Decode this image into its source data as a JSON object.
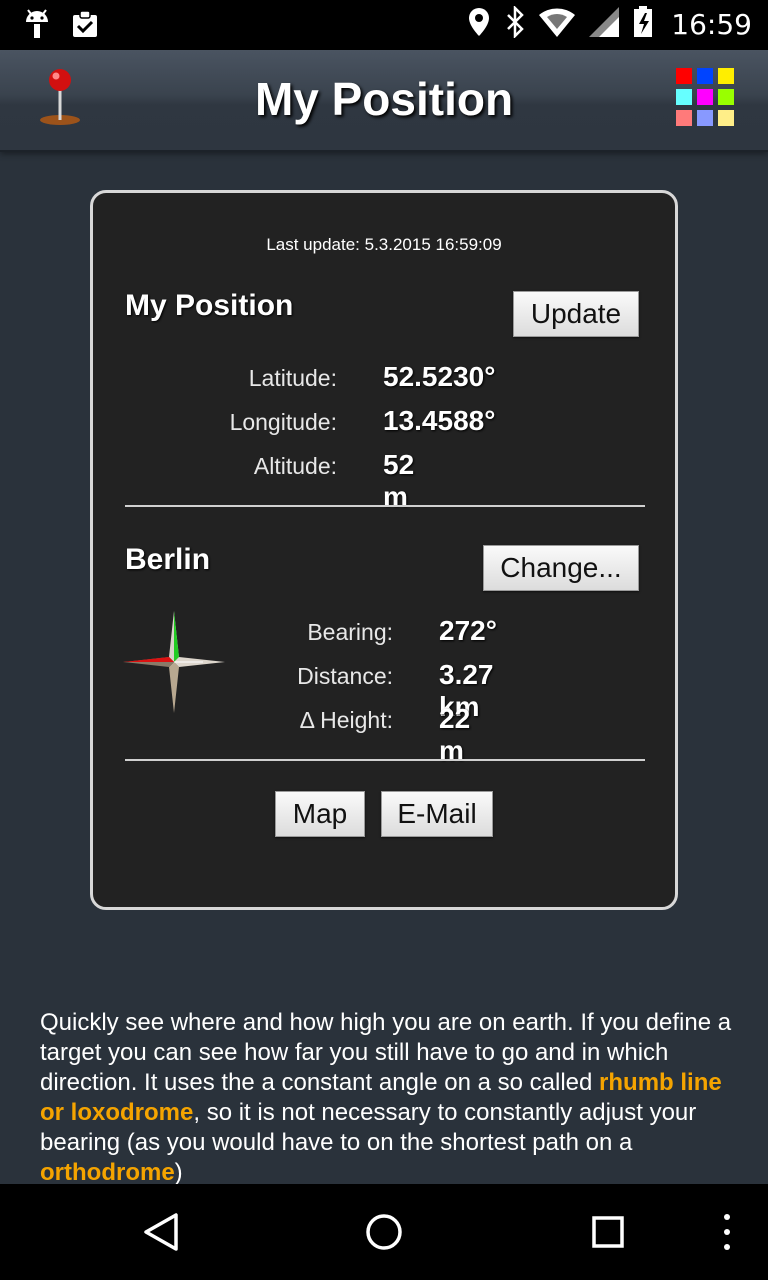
{
  "status_bar": {
    "time": "16:59",
    "left_icons": [
      "android-debug-icon",
      "clipboard-check-icon"
    ],
    "right_icons": [
      "location-icon",
      "bluetooth-icon",
      "wifi-icon",
      "cell-signal-icon",
      "battery-charging-icon"
    ]
  },
  "app_bar": {
    "title": "My Position",
    "app_icon": "map-pin-icon",
    "menu_icon": "color-grid-icon",
    "grid_colors": [
      "#ff0000",
      "#0044ff",
      "#ffee00",
      "#66ffff",
      "#ff00ff",
      "#99ff00",
      "#ff7a7a",
      "#8899ff",
      "#ffee88"
    ]
  },
  "card": {
    "last_update": "Last update: 5.3.2015 16:59:09",
    "position": {
      "title": "My Position",
      "update_button": "Update",
      "rows": [
        {
          "label": "Latitude:",
          "value": "52.5230°"
        },
        {
          "label": "Longitude:",
          "value": "13.4588°"
        },
        {
          "label": "Altitude:",
          "value": "52 m"
        }
      ]
    },
    "target": {
      "title": "Berlin",
      "change_button": "Change...",
      "compass_icon": "compass-icon",
      "rows": [
        {
          "label": "Bearing:",
          "value": "272°"
        },
        {
          "label": "Distance:",
          "value": "3.27 km"
        },
        {
          "label": "Δ Height:",
          "value": "22 m"
        }
      ]
    },
    "map_button": "Map",
    "email_button": "E-Mail"
  },
  "description": {
    "part1": "Quickly see where and how high you are on earth. If you define a target you can see how far you still have to go and in which direction. It uses the a constant angle on a so called ",
    "link1": "rhumb line or loxodrome",
    "part2": ", so it is not necessary to constantly adjust your bearing (as you would have to on the shortest path on a ",
    "link2": "orthodrome",
    "part3": ")"
  },
  "nav_bar": {
    "icons": [
      "back-icon",
      "home-icon",
      "recents-icon",
      "overflow-menu-icon"
    ]
  }
}
